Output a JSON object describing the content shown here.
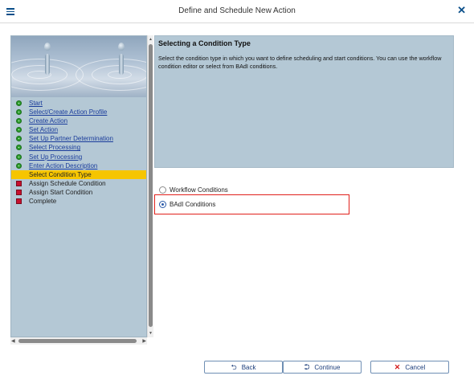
{
  "window": {
    "title": "Define and Schedule New Action",
    "menu_icon": "hamburger-menu-icon",
    "close_icon": "close-icon"
  },
  "wizard_steps": [
    {
      "label": "Start",
      "status": "done",
      "link": true
    },
    {
      "label": "Select/Create Action Profile",
      "status": "done",
      "link": true
    },
    {
      "label": "Create Action",
      "status": "done",
      "link": true
    },
    {
      "label": "Set Action",
      "status": "done",
      "link": true
    },
    {
      "label": "Set Up Partner Determination",
      "status": "done",
      "link": true
    },
    {
      "label": "Select Processing",
      "status": "done",
      "link": true
    },
    {
      "label": "Set Up Processing",
      "status": "done",
      "link": true
    },
    {
      "label": "Enter Action Description",
      "status": "done",
      "link": true
    },
    {
      "label": "Select Condition Type",
      "status": "current",
      "link": false
    },
    {
      "label": "Assign Schedule Condition",
      "status": "todo",
      "link": false
    },
    {
      "label": "Assign Start Condition",
      "status": "todo",
      "link": false
    },
    {
      "label": "Complete",
      "status": "todo",
      "link": false
    }
  ],
  "description": {
    "title": "Selecting a Condition Type",
    "text": "Select the condition type in which you want to define scheduling and start conditions. You can use the workflow condition editor or select from BAdI conditions."
  },
  "options": {
    "workflow": {
      "label": "Workflow Conditions",
      "selected": false
    },
    "badi": {
      "label": "BAdI Conditions",
      "selected": true
    }
  },
  "buttons": {
    "back": {
      "label": "Back",
      "icon": "back-arrow-icon"
    },
    "continue": {
      "label": "Continue",
      "icon": "continue-icon"
    },
    "cancel": {
      "label": "Cancel",
      "icon": "cancel-x-icon"
    }
  },
  "colors": {
    "panel_bg": "#b4c8d5",
    "current_step": "#f6c500",
    "done_status": "#2ea02e",
    "todo_status": "#c8102e",
    "highlight_border": "#e0201b"
  }
}
